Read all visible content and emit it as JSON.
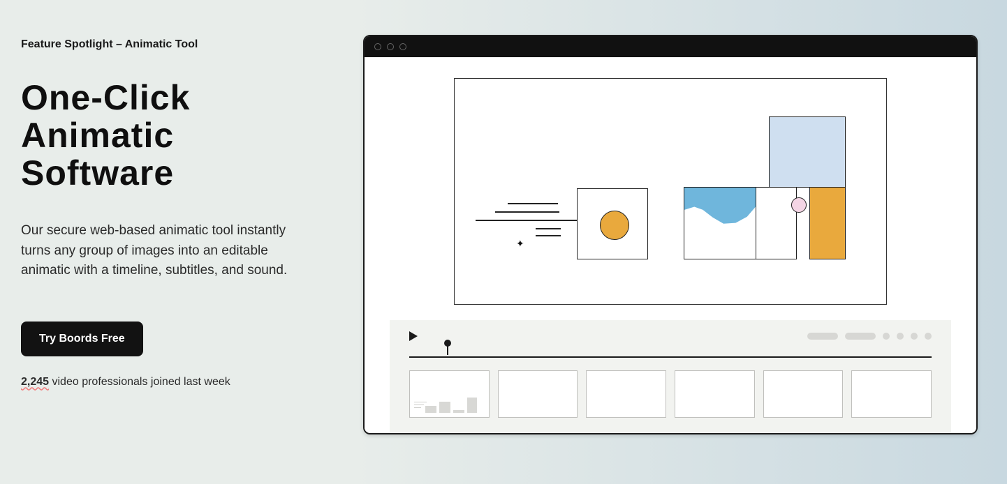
{
  "hero": {
    "spotlight_label": "Feature Spotlight – Animatic Tool",
    "title": "One-Click Animatic Software",
    "description": "Our secure web-based animatic tool instantly turns any group of images into an editable animatic with a timeline, subtitles, and sound.",
    "cta_label": "Try Boords Free",
    "social_count": "2,245",
    "social_text": " video professionals joined last week"
  }
}
